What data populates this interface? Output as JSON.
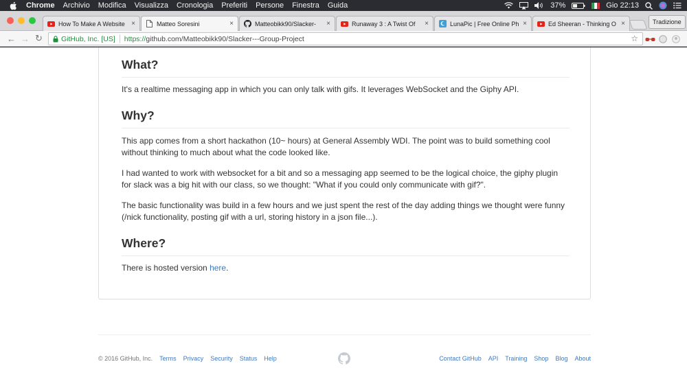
{
  "menubar": {
    "app": "Chrome",
    "items": [
      "Archivio",
      "Modifica",
      "Visualizza",
      "Cronologia",
      "Preferiti",
      "Persone",
      "Finestra",
      "Guida"
    ],
    "battery": "37%",
    "clock": "Gio 22:13"
  },
  "tabs": [
    {
      "title": "How To Make A Website",
      "icon": "youtube-icon",
      "active": false
    },
    {
      "title": "Matteo Soresini",
      "icon": "page-icon",
      "active": true
    },
    {
      "title": "Matteobikk90/Slacker-",
      "icon": "github-icon",
      "active": false
    },
    {
      "title": "Runaway 3 : A Twist Of",
      "icon": "youtube-icon",
      "active": false
    },
    {
      "title": "LunaPic | Free Online Ph",
      "icon": "lunapic-icon",
      "active": false
    },
    {
      "title": "Ed Sheeran - Thinking O",
      "icon": "youtube-icon",
      "active": false
    }
  ],
  "tab_close": "×",
  "translate_button": "Tradizione",
  "omnibox": {
    "secure_label": "GitHub, Inc. [US]",
    "url_proto": "https://",
    "url_rest": "github.com/Matteobikk90/Slacker---Group-Project"
  },
  "readme": {
    "what_heading": "What?",
    "what_text": "It's a realtime messaging app in which you can only talk with gifs. It leverages WebSocket and the Giphy API.",
    "why_heading": "Why?",
    "why_p1": "This app comes from a short hackathon (10~ hours) at General Assembly WDI. The point was to build something cool without thinking to much about what the code looked like.",
    "why_p2": "I had wanted to work with websocket for a bit and so a messaging app seemed to be the logical choice, the giphy plugin for slack was a big hit with our class, so we thought: \"What if you could only communicate with gif?\".",
    "why_p3": "The basic functionality was build in a few hours and we just spent the rest of the day adding things we thought were funny (/nick functionality, posting gif with a url, storing history in a json file...).",
    "where_heading": "Where?",
    "where_prefix": "There is hosted version ",
    "where_link": "here",
    "where_suffix": "."
  },
  "footer": {
    "copyright": "© 2016 GitHub, Inc.",
    "left_links": [
      "Terms",
      "Privacy",
      "Security",
      "Status",
      "Help"
    ],
    "right_links": [
      "Contact GitHub",
      "API",
      "Training",
      "Shop",
      "Blog",
      "About"
    ]
  },
  "colors": {
    "link": "#4078c0",
    "secure_green": "#1f8f3a",
    "youtube_red": "#e62117"
  }
}
